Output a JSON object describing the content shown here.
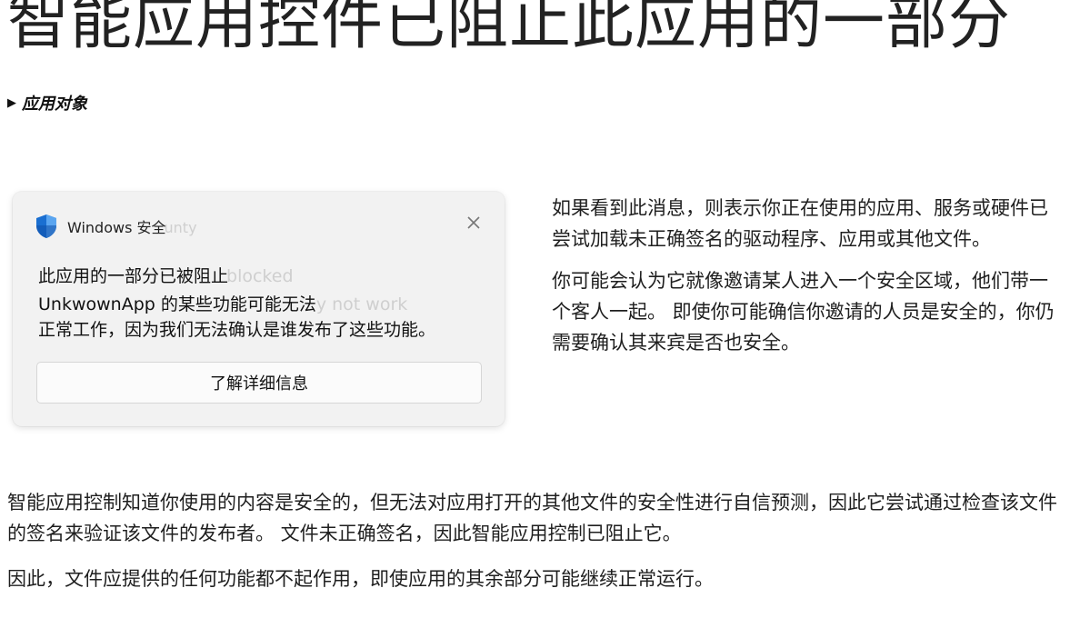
{
  "title": "智能应用控件已阻止此应用的一部分",
  "disclosure": {
    "label": "应用对象"
  },
  "toast": {
    "app_name": "Windows 安全",
    "app_name_ghost": "unty",
    "heading": "此应用的一部分已被阻止",
    "heading_ghost": "blocked",
    "body_line1": "UnkwownApp 的某些功能可能无法",
    "body_line1_ghost": "y not work",
    "body_line2": "正常工作，因为我们无法确认是谁发布了这些功能。",
    "button_label": "了解详细信息"
  },
  "side": {
    "p1": "如果看到此消息，则表示你正在使用的应用、服务或硬件已尝试加载未正确签名的驱动程序、应用或其他文件。",
    "p2": "你可能会认为它就像邀请某人进入一个安全区域，他们带一个客人一起。 即使你可能确信你邀请的人员是安全的，你仍需要确认其来宾是否也安全。"
  },
  "bottom": {
    "p1": "智能应用控制知道你使用的内容是安全的，但无法对应用打开的其他文件的安全性进行自信预测，因此它尝试通过检查该文件的签名来验证该文件的发布者。 文件未正确签名，因此智能应用控制已阻止它。",
    "p2": "因此，文件应提供的任何功能都不起作用，即使应用的其余部分可能继续正常运行。"
  },
  "colors": {
    "shield_blue": "#1a6fd1",
    "shield_light": "#5aa5f0",
    "card_bg": "#f2f2f2"
  }
}
